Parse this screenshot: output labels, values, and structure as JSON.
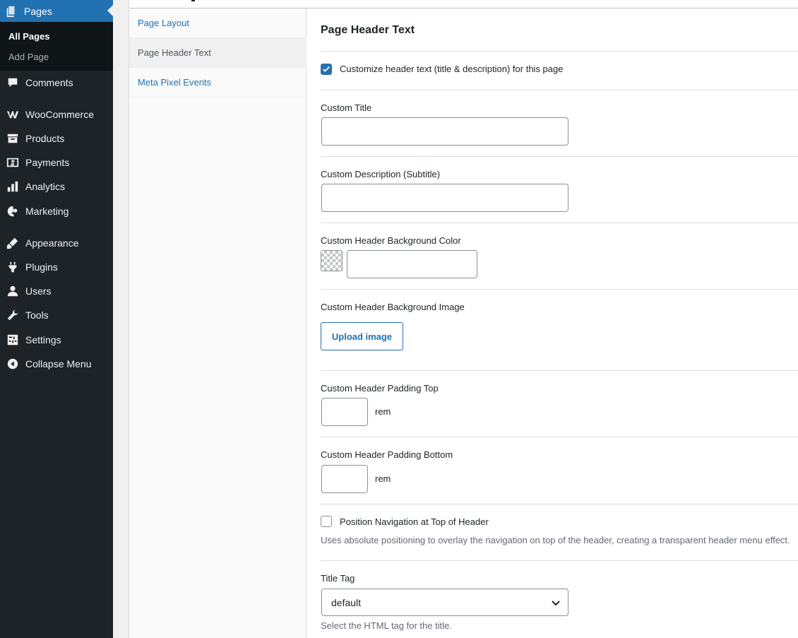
{
  "sidebar": {
    "current": {
      "label": "Pages",
      "icon": "pages-icon"
    },
    "submenu": [
      {
        "label": "All Pages",
        "current": true
      },
      {
        "label": "Add Page",
        "current": false
      }
    ],
    "items": [
      {
        "label": "Comments",
        "icon": "comments-icon"
      },
      {
        "label": "WooCommerce",
        "icon": "woocommerce-icon"
      },
      {
        "label": "Products",
        "icon": "products-icon"
      },
      {
        "label": "Payments",
        "icon": "payments-icon"
      },
      {
        "label": "Analytics",
        "icon": "analytics-icon"
      },
      {
        "label": "Marketing",
        "icon": "marketing-icon"
      },
      {
        "label": "Appearance",
        "icon": "appearance-icon"
      },
      {
        "label": "Plugins",
        "icon": "plugins-icon"
      },
      {
        "label": "Users",
        "icon": "users-icon"
      },
      {
        "label": "Tools",
        "icon": "tools-icon"
      },
      {
        "label": "Settings",
        "icon": "settings-icon"
      },
      {
        "label": "Collapse Menu",
        "icon": "collapse-icon"
      }
    ]
  },
  "tabs": [
    {
      "label": "Page Layout",
      "active": false
    },
    {
      "label": "Page Header Text",
      "active": true
    },
    {
      "label": "Meta Pixel Events",
      "active": false
    }
  ],
  "section": {
    "title": "Page Header Text",
    "customize_checkbox": {
      "label": "Customize header text (title & description) for this page",
      "checked": true
    },
    "custom_title": {
      "label": "Custom Title",
      "value": ""
    },
    "custom_description": {
      "label": "Custom Description (Subtitle)",
      "value": ""
    },
    "bg_color": {
      "label": "Custom Header Background Color",
      "value": ""
    },
    "bg_image": {
      "label": "Custom Header Background Image",
      "button": "Upload image"
    },
    "padding_top": {
      "label": "Custom Header Padding Top",
      "value": "",
      "unit": "rem"
    },
    "padding_bottom": {
      "label": "Custom Header Padding Bottom",
      "value": "",
      "unit": "rem"
    },
    "position_nav": {
      "label": "Position Navigation at Top of Header",
      "checked": false,
      "description": "Uses absolute positioning to overlay the navigation on top of the header, creating a transparent header menu effect."
    },
    "title_tag": {
      "label": "Title Tag",
      "selected": "default",
      "description": "Select the HTML tag for the title."
    }
  },
  "colors": {
    "accent": "#2271b1",
    "sidebar_bg": "#1d2327",
    "submenu_bg": "#101517"
  }
}
